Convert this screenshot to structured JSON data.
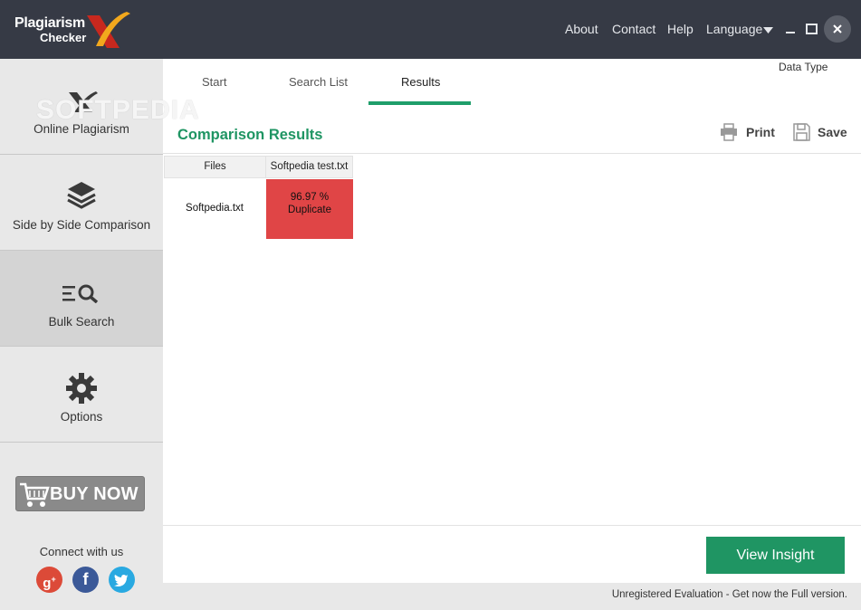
{
  "app": {
    "logo_line1": "Plagiarism",
    "logo_line2": "Checker"
  },
  "titlebar": {
    "nav": [
      "About",
      "Contact",
      "Help",
      "Language"
    ]
  },
  "sidebar": {
    "watermark": "SOFTPEDIA",
    "items": [
      {
        "label": "Online Plagiarism",
        "icon": "logo-x-icon"
      },
      {
        "label": "Side by Side Comparison",
        "icon": "layers-icon"
      },
      {
        "label": "Bulk Search",
        "icon": "search-list-icon"
      },
      {
        "label": "Options",
        "icon": "gear-icon"
      }
    ],
    "active_index": 2,
    "buy_label": "BUY NOW",
    "connect_label": "Connect with us"
  },
  "main": {
    "tabs": [
      {
        "label": "Start"
      },
      {
        "label": "Search List"
      },
      {
        "label": "Results"
      }
    ],
    "active_tab": "Results",
    "data_type_label": "Data Type",
    "section_title": "Comparison Results",
    "print_label": "Print",
    "save_label": "Save",
    "table": {
      "headers": [
        "Files",
        "Softpedia test.txt"
      ],
      "rows": [
        {
          "file": "Softpedia.txt",
          "percent": "96.97 %",
          "status": "Duplicate"
        }
      ]
    },
    "view_insight_label": "View Insight"
  },
  "status": {
    "text": "Unregistered Evaluation - Get now the Full version."
  },
  "colors": {
    "titlebar": "#363a45",
    "accent": "#1f9563",
    "duplicate": "#e04546",
    "sidebar": "#e8e8e8"
  }
}
